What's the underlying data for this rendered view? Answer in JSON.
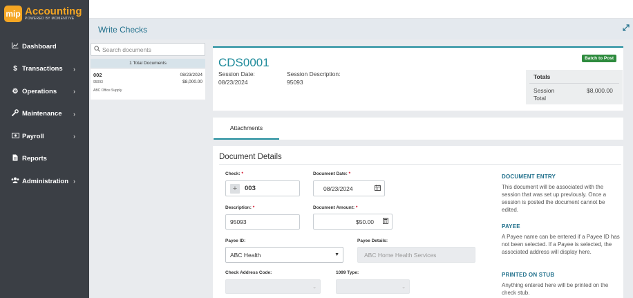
{
  "app": {
    "logo_badge": "mip",
    "logo_title": "Accounting",
    "logo_sub": "POWERED BY MOMENTIVE",
    "accent": "#1f8b9b",
    "sidebar_bg": "#3b3f45"
  },
  "sidebar": {
    "items": [
      {
        "label": "Dashboard",
        "icon": "chart-line-icon",
        "has_children": false
      },
      {
        "label": "Transactions",
        "icon": "dollar-icon",
        "has_children": true
      },
      {
        "label": "Operations",
        "icon": "gears-icon",
        "has_children": true
      },
      {
        "label": "Maintenance",
        "icon": "wrench-icon",
        "has_children": true
      },
      {
        "label": "Payroll",
        "icon": "money-icon",
        "has_children": true
      },
      {
        "label": "Reports",
        "icon": "file-icon",
        "has_children": false
      },
      {
        "label": "Administration",
        "icon": "users-icon",
        "has_children": true
      }
    ]
  },
  "page": {
    "title": "Write Checks"
  },
  "doc_list": {
    "search_placeholder": "Search documents",
    "total_label": "1 Total Documents",
    "items": [
      {
        "number": "002",
        "date": "08/23/2024",
        "sub": "95093",
        "amount": "$8,000.00",
        "vendor": "ABC Office Supply"
      }
    ]
  },
  "session": {
    "id": "CDS0001",
    "batch_button": "Batch to Post",
    "date_label": "Session Date:",
    "date_value": "08/23/2024",
    "desc_label": "Session Description:",
    "desc_value": "95093",
    "totals_title": "Totals",
    "totals_label": "Session Total",
    "totals_value": "$8,000.00"
  },
  "tabs": {
    "attachments": "Attachments"
  },
  "details": {
    "title": "Document Details",
    "check_label": "Check:",
    "check_value": "003",
    "doc_date_label": "Document Date:",
    "doc_date_value": "08/23/2024",
    "description_label": "Description:",
    "description_value": "95093",
    "amount_label": "Document Amount:",
    "amount_value": "$50.00",
    "payee_id_label": "Payee ID:",
    "payee_id_value": "ABC Health",
    "payee_details_label": "Payee Details:",
    "payee_details_value": "ABC Home Health Services",
    "check_address_label": "Check Address Code:",
    "type_1099_label": "1099 Type:"
  },
  "help": {
    "entry_title": "DOCUMENT ENTRY",
    "entry_text": "This document will be associated with the session that was set up previously. Once a session is posted the document cannot be edited.",
    "payee_title": "PAYEE",
    "payee_text": "A Payee name can be entered if a Payee ID has not been selected. If a Payee is selected, the associated address will display here.",
    "stub_title": "PRINTED ON STUB",
    "stub_text": "Anything entered here will be printed on the check stub."
  }
}
